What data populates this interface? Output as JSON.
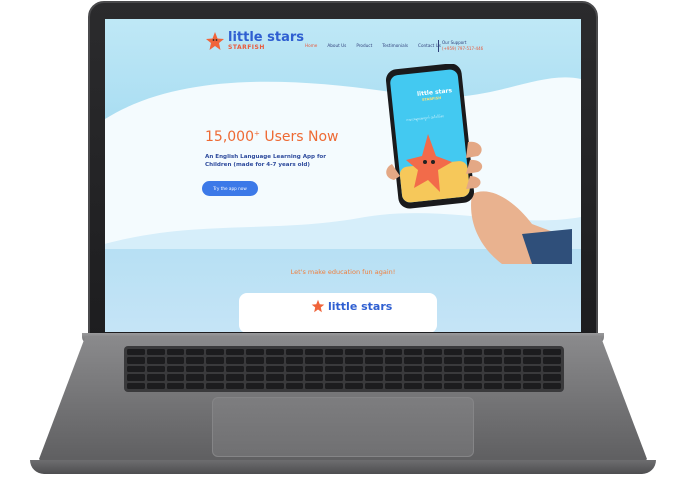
{
  "site": {
    "logo_title": "little stars",
    "logo_subtitle": "STARFISH",
    "nav": [
      {
        "label": "Home",
        "active": true
      },
      {
        "label": "About Us",
        "active": false
      },
      {
        "label": "Product",
        "active": false
      },
      {
        "label": "Testimonials",
        "active": false
      },
      {
        "label": "Contact Us",
        "active": false
      }
    ],
    "support_label": "Our Support",
    "support_phone": "(+959) 797-517-446"
  },
  "hero": {
    "title": "15,000",
    "title_sup": "+",
    "title_suffix": " Users Now",
    "description": "An English Language Learning App for Children (made for 4-7 years old)",
    "cta_label": "Try the app now"
  },
  "phone_screen": {
    "app_title": "little stars",
    "app_subtitle": "STARFISH",
    "app_text": "ကလေးများအတွက် အင်္ဂလိပ်စာ"
  },
  "tagline": "Let's make education fun again!",
  "card": {
    "logo_title": "little stars"
  },
  "colors": {
    "brand_blue": "#2f5fd1",
    "brand_orange": "#ee6a34",
    "cta_blue": "#3c79e8",
    "sky": "#a5dbf1"
  }
}
